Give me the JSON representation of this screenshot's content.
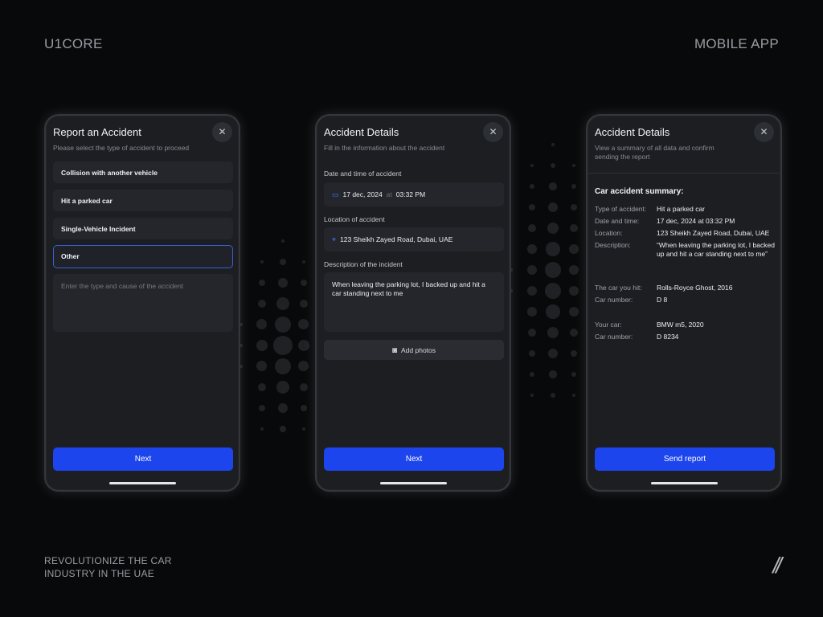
{
  "header": {
    "brand": "U1CORE",
    "section": "MOBILE APP"
  },
  "footer": {
    "tagline": "REVOLUTIONIZE THE CAR\nINDUSTRY IN THE UAE",
    "mark": "//"
  },
  "colors": {
    "accent": "#1c45ee",
    "background": "#08090b",
    "card": "#1c1e22"
  },
  "screen1": {
    "title": "Report an Accident",
    "subtitle": "Please select the type of accident to proceed",
    "close_icon": "close-icon",
    "options": [
      "Collision with another vehicle",
      "Hit a parked car",
      "Single-Vehicle Incident",
      "Other"
    ],
    "selected": "Other",
    "textarea_placeholder": "Enter the type and cause of the accident",
    "button": "Next"
  },
  "screen2": {
    "title": "Accident Details",
    "subtitle": "Fill in the information about the accident",
    "datetime_label": "Date and time of accident",
    "date": "17 dec, 2024",
    "at": "at",
    "time": "03:32 PM",
    "location_label": "Location of accident",
    "location": "123 Sheikh Zayed Road, Dubai, UAE",
    "description_label": "Description of the incident",
    "description": "When leaving the parking lot, I backed up and hit a car standing next to me",
    "add_photos": "Add photos",
    "button": "Next"
  },
  "screen3": {
    "title": "Accident Details",
    "subtitle": "View a summary of all data and confirm sending the report",
    "summary_title": "Car accident summary:",
    "rows": [
      {
        "k": "Type of accident:",
        "v": "Hit a parked car"
      },
      {
        "k": "Date and time:",
        "v": "17 dec, 2024 at 03:32 PM"
      },
      {
        "k": "Location:",
        "v": "123 Sheikh Zayed Road, Dubai, UAE"
      },
      {
        "k": "Description:",
        "v": "“When leaving the parking lot, I backed up and hit a car standing next to me”"
      },
      {
        "k": "The car you hit:",
        "v": "Rolls-Royce Ghost, 2016"
      },
      {
        "k": "Car number:",
        "v": "D 8"
      },
      {
        "k": "Your car:",
        "v": "BMW m5, 2020"
      },
      {
        "k": "Car number:",
        "v": "D 8234"
      }
    ],
    "button": "Send report"
  }
}
